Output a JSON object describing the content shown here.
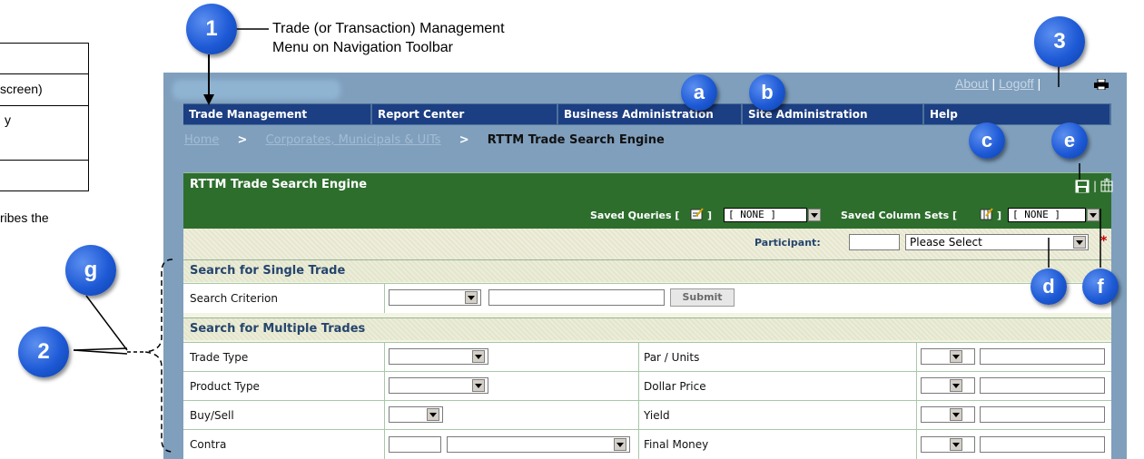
{
  "left_doc": {
    "line1": "screen)",
    "line2": "y",
    "line3": "ribes the"
  },
  "callouts": {
    "c1": "1",
    "c1_label_line1": "Trade (or Transaction) Management",
    "c1_label_line2": "Menu on Navigation Toolbar",
    "c2": "2",
    "c3": "3",
    "ca": "a",
    "cb": "b",
    "cc": "c",
    "cd": "d",
    "ce": "e",
    "cf": "f",
    "cg": "g"
  },
  "toplinks": {
    "about": "About",
    "sep": "|",
    "logoff": "Logoff",
    "sep2": "|"
  },
  "nav": [
    {
      "label": "Trade Management"
    },
    {
      "label": "Report Center"
    },
    {
      "label": "Business Administration"
    },
    {
      "label": "Site Administration"
    },
    {
      "label": "Help"
    }
  ],
  "breadcrumb": {
    "home": "Home",
    "sep": ">",
    "corporates": "Corporates, Municipals & UITs",
    "current": "RTTM Trade Search Engine"
  },
  "panel": {
    "title": "RTTM Trade Search Engine",
    "saved_queries_label": "Saved Queries [",
    "saved_queries_close": "]",
    "saved_queries_value": "[ NONE ]",
    "saved_colsets_label": "Saved Column Sets [",
    "saved_colsets_close": "]",
    "saved_colsets_value": "[ NONE ]",
    "participant_label": "Participant:",
    "participant_select": "Please Select",
    "required_mark": "*"
  },
  "single": {
    "title": "Search for Single Trade",
    "criterion_label": "Search Criterion",
    "submit": "Submit"
  },
  "multiple": {
    "title": "Search for Multiple Trades",
    "rows": [
      {
        "left": "Trade Type",
        "right": "Par / Units"
      },
      {
        "left": "Product Type",
        "right": "Dollar Price"
      },
      {
        "left": "Buy/Sell",
        "right": "Yield"
      },
      {
        "left": "Contra",
        "right": "Final Money"
      }
    ]
  }
}
